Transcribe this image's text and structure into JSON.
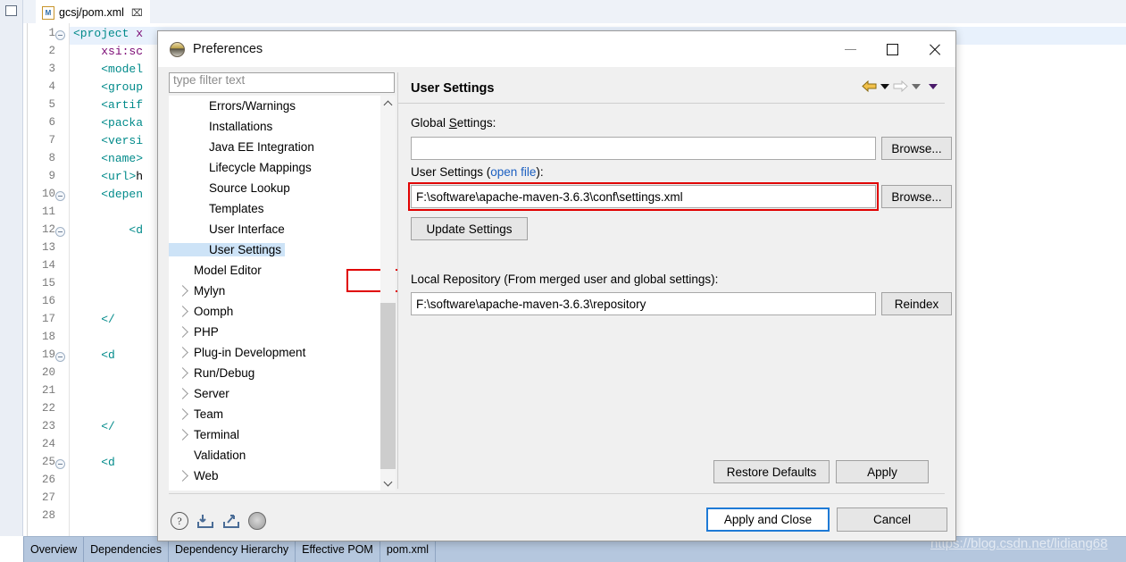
{
  "workspace": {
    "editor_tab": {
      "label": "gcsj/pom.xml",
      "icon": "maven-pom-file-icon",
      "close": "⌧",
      "file_glyph": "M"
    },
    "minimize_icon": "restore-window-icon",
    "gutter": {
      "line_numbers": [
        "1",
        "2",
        "3",
        "4",
        "5",
        "6",
        "7",
        "8",
        "9",
        "10",
        "11",
        "12",
        "13",
        "14",
        "15",
        "16",
        "17",
        "18",
        "19",
        "20",
        "21",
        "22",
        "23",
        "24",
        "25",
        "26",
        "27",
        "28"
      ],
      "fold_lines": [
        1,
        10,
        12,
        19,
        25
      ]
    },
    "code_lines": [
      {
        "line": 1,
        "text": "<project x"
      },
      {
        "line": 2,
        "text": "    xsi:sc"
      },
      {
        "line": 3,
        "text": "    <model"
      },
      {
        "line": 4,
        "text": "    <group"
      },
      {
        "line": 5,
        "text": "    <artif"
      },
      {
        "line": 6,
        "text": "    <packa"
      },
      {
        "line": 7,
        "text": "    <versi"
      },
      {
        "line": 8,
        "text": "    <name>"
      },
      {
        "line": 9,
        "text": "    <url>h"
      },
      {
        "line": 10,
        "text": "    <depen"
      },
      {
        "line": 12,
        "text": "        <d"
      },
      {
        "line": 17,
        "text": "    </"
      },
      {
        "line": 19,
        "text": "    <d"
      },
      {
        "line": 23,
        "text": "    </"
      },
      {
        "line": 25,
        "text": "    <d"
      }
    ],
    "form_tabs": [
      "Overview",
      "Dependencies",
      "Dependency Hierarchy",
      "Effective POM",
      "pom.xml"
    ],
    "watermark": "https://blog.csdn.net/lidiang68"
  },
  "dialog": {
    "title": "Preferences",
    "app_icon": "eclipse-sphere-icon",
    "window_buttons": {
      "minimize": "minimize-icon",
      "maximize": "maximize-icon",
      "close": "close-icon"
    },
    "filter": {
      "placeholder": "type filter text",
      "value": ""
    },
    "tree": [
      {
        "label": "Errors/Warnings",
        "expandable": false,
        "indent": true,
        "selected": false
      },
      {
        "label": "Installations",
        "expandable": false,
        "indent": true,
        "selected": false
      },
      {
        "label": "Java EE Integration",
        "expandable": false,
        "indent": true,
        "selected": false
      },
      {
        "label": "Lifecycle Mappings",
        "expandable": false,
        "indent": true,
        "selected": false
      },
      {
        "label": "Source Lookup",
        "expandable": false,
        "indent": true,
        "selected": false
      },
      {
        "label": "Templates",
        "expandable": false,
        "indent": true,
        "selected": false
      },
      {
        "label": "User Interface",
        "expandable": false,
        "indent": true,
        "selected": false
      },
      {
        "label": "User Settings",
        "expandable": false,
        "indent": true,
        "selected": true
      },
      {
        "label": "Model Editor",
        "expandable": false,
        "indent": false,
        "selected": false
      },
      {
        "label": "Mylyn",
        "expandable": true,
        "indent": false,
        "selected": false
      },
      {
        "label": "Oomph",
        "expandable": true,
        "indent": false,
        "selected": false
      },
      {
        "label": "PHP",
        "expandable": true,
        "indent": false,
        "selected": false
      },
      {
        "label": "Plug-in Development",
        "expandable": true,
        "indent": false,
        "selected": false
      },
      {
        "label": "Run/Debug",
        "expandable": true,
        "indent": false,
        "selected": false
      },
      {
        "label": "Server",
        "expandable": true,
        "indent": false,
        "selected": false
      },
      {
        "label": "Team",
        "expandable": true,
        "indent": false,
        "selected": false
      },
      {
        "label": "Terminal",
        "expandable": true,
        "indent": false,
        "selected": false
      },
      {
        "label": "Validation",
        "expandable": false,
        "indent": false,
        "selected": false
      },
      {
        "label": "Web",
        "expandable": true,
        "indent": false,
        "selected": false
      }
    ],
    "page": {
      "title": "User Settings",
      "nav": {
        "back": "back-arrow-icon",
        "back_menu": "back-dropdown-icon",
        "forward": "forward-arrow-icon",
        "forward_menu": "forward-dropdown-icon",
        "view_menu": "view-menu-icon"
      },
      "global_settings": {
        "label_pre": "Global ",
        "label_mnemonic": "S",
        "label_post": "ettings:",
        "value": "",
        "browse_label": "Browse..."
      },
      "user_settings": {
        "label_pre": "User Settings (",
        "link": "open file",
        "label_post": "):",
        "value": "F:\\software\\apache-maven-3.6.3\\conf\\settings.xml",
        "browse_label": "Browse...",
        "update_label": "Update Settings",
        "highlighted": true
      },
      "local_repository": {
        "label": "Local Repository (From merged user and global settings):",
        "value": "F:\\software\\apache-maven-3.6.3\\repository",
        "reindex_label": "Reindex"
      },
      "restore_defaults_label": "Restore Defaults",
      "apply_label": "Apply"
    },
    "footer": {
      "icons": [
        "help-icon",
        "import-icon",
        "export-icon",
        "toggle-icon"
      ],
      "apply_and_close_label": "Apply and Close",
      "cancel_label": "Cancel"
    }
  },
  "colors": {
    "accent": "#1e7ad6",
    "highlight_red": "#e00000",
    "selection_blue": "#cde3f7",
    "link_blue": "#1b5fc1",
    "dialog_bg": "#f0f0f0"
  }
}
